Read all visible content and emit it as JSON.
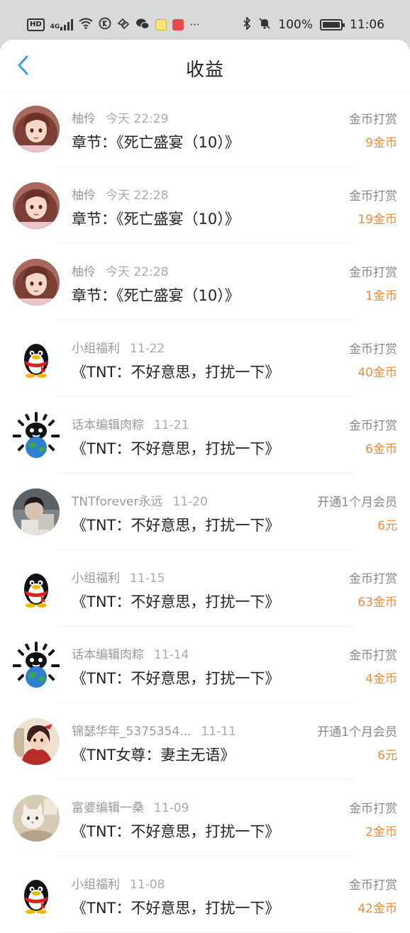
{
  "status_bar": {
    "left_icons": [
      "hd-icon",
      "signal-4g-icon",
      "wifi-icon",
      "app-k-icon",
      "app-heart-icon",
      "wechat-icon",
      "app-yellow-icon",
      "app-red-icon",
      "more-dots-icon"
    ],
    "hd_label": "HD",
    "net_label": "4G",
    "more": "···",
    "battery": "100%",
    "time": "11:06"
  },
  "header": {
    "title": "收益"
  },
  "rows": [
    {
      "avatar": "avatar-girl",
      "name": "柚伶",
      "date": "今天 22:29",
      "work": "章节：《死亡盛宴（10）》",
      "type": "金币打赏",
      "amount": "9金币"
    },
    {
      "avatar": "avatar-girl",
      "name": "柚伶",
      "date": "今天 22:28",
      "work": "章节：《死亡盛宴（10）》",
      "type": "金币打赏",
      "amount": "19金币"
    },
    {
      "avatar": "avatar-girl",
      "name": "柚伶",
      "date": "今天 22:28",
      "work": "章节：《死亡盛宴（10）》",
      "type": "金币打赏",
      "amount": "1金币"
    },
    {
      "avatar": "avatar-penguin",
      "name": "小组福利",
      "date": "11-22",
      "work": "《TNT：不好意思，打扰一下》",
      "type": "金币打赏",
      "amount": "40金币"
    },
    {
      "avatar": "avatar-globe",
      "name": "话本编辑肉粽",
      "date": "11-21",
      "work": "《TNT：不好意思，打扰一下》",
      "type": "金币打赏",
      "amount": "6金币"
    },
    {
      "avatar": "avatar-photo",
      "name": "TNTforever永远",
      "date": "11-20",
      "work": "《TNT：不好意思，打扰一下》",
      "type": "开通1个月会员",
      "amount": "6元"
    },
    {
      "avatar": "avatar-penguin",
      "name": "小组福利",
      "date": "11-15",
      "work": "《TNT：不好意思，打扰一下》",
      "type": "金币打赏",
      "amount": "63金币"
    },
    {
      "avatar": "avatar-globe",
      "name": "话本编辑肉粽",
      "date": "11-14",
      "work": "《TNT：不好意思，打扰一下》",
      "type": "金币打赏",
      "amount": "4金币"
    },
    {
      "avatar": "avatar-anime",
      "name": "锦瑟华年_5375354...",
      "date": "11-11",
      "work": "《TNT女尊：妻主无语》",
      "type": "开通1个月会员",
      "amount": "6元"
    },
    {
      "avatar": "avatar-cat",
      "name": "富婆编辑一桑",
      "date": "11-09",
      "work": "《TNT：不好意思，打扰一下》",
      "type": "金币打赏",
      "amount": "2金币"
    },
    {
      "avatar": "avatar-penguin",
      "name": "小组福利",
      "date": "11-08",
      "work": "《TNT：不好意思，打扰一下》",
      "type": "金币打赏",
      "amount": "42金币"
    }
  ],
  "colors": {
    "accent_blue": "#3a9cf0",
    "amount_orange": "#f08a3c"
  }
}
